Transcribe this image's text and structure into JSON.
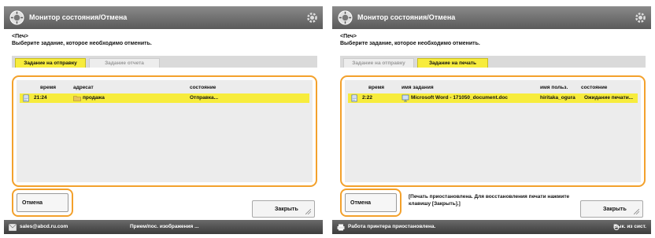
{
  "left": {
    "window_title": "Монитор состояния/Отмена",
    "header_line1": "<Печ>",
    "header_line2": "Выберите задание, которое необходимо отменить.",
    "tabs": [
      {
        "label": "Задание на отправку",
        "active": true
      },
      {
        "label": "Задание отчета",
        "active": false
      }
    ],
    "columns": {
      "time": "время",
      "address": "адресат",
      "status": "состояние"
    },
    "rows": [
      {
        "time": "21:24",
        "address": "продажа",
        "status": "Отправка..."
      }
    ],
    "cancel_label": "Отмена",
    "close_label": "Закрыть",
    "status_left": "sales@abcd.ru.com",
    "status_mid": "Прием/пос. изображения ..."
  },
  "right": {
    "window_title": "Монитор состояния/Отмена",
    "header_line1": "<Печ>",
    "header_line2": "Выберите задание, которое необходимо отменить.",
    "tabs": [
      {
        "label": "Задание на отправку",
        "active": false
      },
      {
        "label": "Задание на печать",
        "active": true
      }
    ],
    "columns": {
      "time": "время",
      "job_name": "имя задания",
      "user_name": "имя польз.",
      "status": "состояние"
    },
    "rows": [
      {
        "time": "2:22",
        "job_name": "Microsoft Word - 171050_document.doc",
        "user_name": "hiritaka_ogura",
        "status": "Ожидание печати..."
      }
    ],
    "cancel_label": "Отмена",
    "message_line1": "[Печать приостановлена. Для восстановления печати нажмите",
    "message_line2": "клавишу [Закрыть].]",
    "close_label": "Закрыть",
    "status_left": "Работа принтера приостановлена.",
    "status_right": "Вык. из сист."
  },
  "colors": {
    "accent": "#f3a12c",
    "selected": "#f7ec3c",
    "titlebar": "#6e6e6e"
  }
}
